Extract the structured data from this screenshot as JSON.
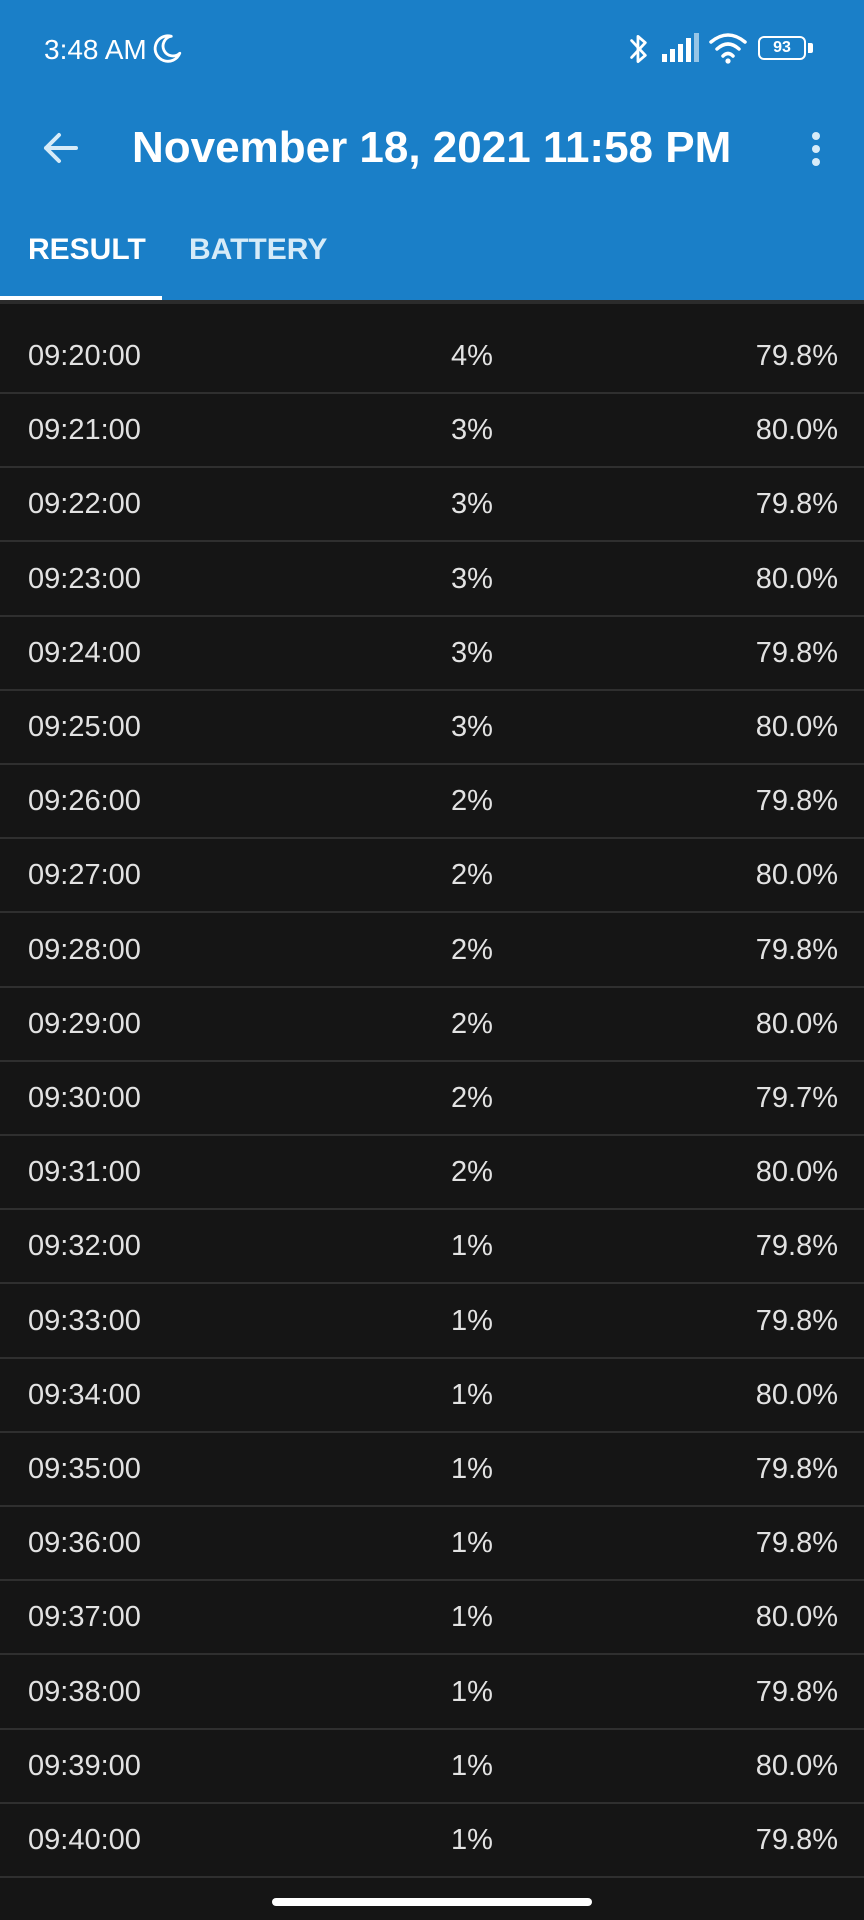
{
  "status_bar": {
    "time": "3:48 AM",
    "battery_level": "93",
    "icons": [
      "moon-icon",
      "bluetooth-icon",
      "signal-icon",
      "wifi-icon",
      "battery-icon"
    ]
  },
  "toolbar": {
    "title": "November 18, 2021 11:58 PM",
    "back_icon": "arrow-left-icon",
    "more_icon": "more-vertical-icon"
  },
  "tabs": [
    {
      "label": "RESULT",
      "active": true
    },
    {
      "label": "BATTERY",
      "active": false
    }
  ],
  "rows": [
    {
      "time": "09:20:00",
      "level": "4%",
      "temp": "79.8%"
    },
    {
      "time": "09:21:00",
      "level": "3%",
      "temp": "80.0%"
    },
    {
      "time": "09:22:00",
      "level": "3%",
      "temp": "79.8%"
    },
    {
      "time": "09:23:00",
      "level": "3%",
      "temp": "80.0%"
    },
    {
      "time": "09:24:00",
      "level": "3%",
      "temp": "79.8%"
    },
    {
      "time": "09:25:00",
      "level": "3%",
      "temp": "80.0%"
    },
    {
      "time": "09:26:00",
      "level": "2%",
      "temp": "79.8%"
    },
    {
      "time": "09:27:00",
      "level": "2%",
      "temp": "80.0%"
    },
    {
      "time": "09:28:00",
      "level": "2%",
      "temp": "79.8%"
    },
    {
      "time": "09:29:00",
      "level": "2%",
      "temp": "80.0%"
    },
    {
      "time": "09:30:00",
      "level": "2%",
      "temp": "79.7%"
    },
    {
      "time": "09:31:00",
      "level": "2%",
      "temp": "80.0%"
    },
    {
      "time": "09:32:00",
      "level": "1%",
      "temp": "79.8%"
    },
    {
      "time": "09:33:00",
      "level": "1%",
      "temp": "79.8%"
    },
    {
      "time": "09:34:00",
      "level": "1%",
      "temp": "80.0%"
    },
    {
      "time": "09:35:00",
      "level": "1%",
      "temp": "79.8%"
    },
    {
      "time": "09:36:00",
      "level": "1%",
      "temp": "79.8%"
    },
    {
      "time": "09:37:00",
      "level": "1%",
      "temp": "80.0%"
    },
    {
      "time": "09:38:00",
      "level": "1%",
      "temp": "79.8%"
    },
    {
      "time": "09:39:00",
      "level": "1%",
      "temp": "80.0%"
    },
    {
      "time": "09:40:00",
      "level": "1%",
      "temp": "79.8%"
    }
  ],
  "colors": {
    "header": "#1a7fc8",
    "background": "#151515",
    "row_divider": "#2f2f2f",
    "text": "#e2e2e2"
  }
}
